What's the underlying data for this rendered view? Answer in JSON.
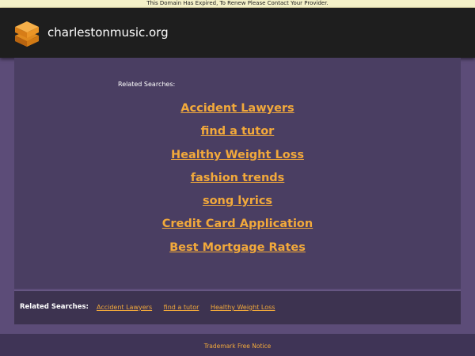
{
  "notice": {
    "text": "This Domain Has Expired, To Renew Please Contact Your Provider."
  },
  "header": {
    "domain": "charlestonmusic.org",
    "logo_icon": "stacked-layers-icon"
  },
  "main": {
    "label": "Related Searches:",
    "links": [
      "Accident Lawyers",
      "find a tutor",
      "Healthy Weight Loss",
      "fashion trends",
      "song lyrics",
      "Credit Card Application",
      "Best Mortgage Rates"
    ]
  },
  "bottom": {
    "label": "Related Searches:",
    "links": [
      "Accident Lawyers",
      "find a tutor",
      "Healthy Weight Loss"
    ]
  },
  "footer": {
    "link": "Trademark Free Notice"
  },
  "colors": {
    "link": "#f2a93b",
    "background": "#5c4c78",
    "panel": "#4a3e62",
    "header": "#1e1e1e",
    "notice": "#f4f1c8"
  }
}
